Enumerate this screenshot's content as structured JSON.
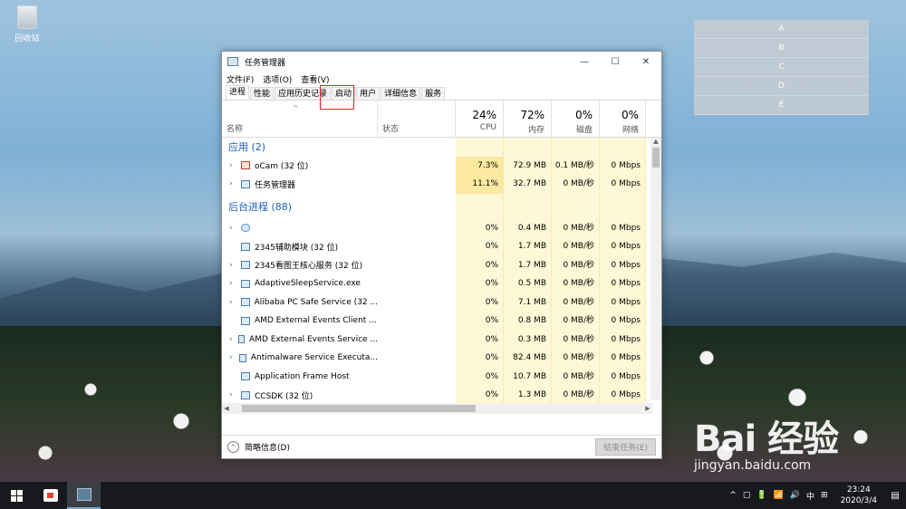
{
  "desktop": {
    "recycle_bin_label": "回收站"
  },
  "overlay_rows": [
    "A",
    "B",
    "C",
    "D",
    "E"
  ],
  "window": {
    "title": "任务管理器",
    "controls": {
      "minimize": "—",
      "maximize": "☐",
      "close": "✕"
    }
  },
  "menu": [
    "文件(F)",
    "选项(O)",
    "查看(V)"
  ],
  "tabs": [
    "进程",
    "性能",
    "应用历史记录",
    "启动",
    "用户",
    "详细信息",
    "服务"
  ],
  "active_tab": "进程",
  "highlighted_tab": "启动",
  "header": {
    "name_label": "名称",
    "status_label": "状态",
    "sort_glyph": "^",
    "columns": [
      {
        "pct": "24%",
        "label": "CPU"
      },
      {
        "pct": "72%",
        "label": "内存"
      },
      {
        "pct": "0%",
        "label": "磁盘"
      },
      {
        "pct": "0%",
        "label": "网络"
      }
    ]
  },
  "groups": {
    "apps": "应用 (2)",
    "background": "后台进程 (88)"
  },
  "apps": [
    {
      "name": "oCam (32 位)",
      "cpu": "7.3%",
      "mem": "72.9 MB",
      "disk": "0.1 MB/秒",
      "net": "0 Mbps",
      "icon": "ocam-icon",
      "hot": true
    },
    {
      "name": "任务管理器",
      "cpu": "11.1%",
      "mem": "32.7 MB",
      "disk": "0 MB/秒",
      "net": "0 Mbps",
      "icon": "task-manager-icon",
      "hot": true
    }
  ],
  "background": [
    {
      "name": "",
      "cpu": "0%",
      "mem": "0.4 MB",
      "disk": "0 MB/秒",
      "net": "0 Mbps",
      "icon": "gear-icon",
      "expand": true
    },
    {
      "name": "2345辅助模块 (32 位)",
      "cpu": "0%",
      "mem": "1.7 MB",
      "disk": "0 MB/秒",
      "net": "0 Mbps",
      "icon": "process-icon",
      "expand": false
    },
    {
      "name": "2345看图王核心服务 (32 位)",
      "cpu": "0%",
      "mem": "1.7 MB",
      "disk": "0 MB/秒",
      "net": "0 Mbps",
      "icon": "process-icon",
      "expand": true
    },
    {
      "name": "AdaptiveSleepService.exe",
      "cpu": "0%",
      "mem": "0.5 MB",
      "disk": "0 MB/秒",
      "net": "0 Mbps",
      "icon": "process-icon",
      "expand": true
    },
    {
      "name": "Alibaba PC Safe Service (32 ...",
      "cpu": "0%",
      "mem": "7.1 MB",
      "disk": "0 MB/秒",
      "net": "0 Mbps",
      "icon": "process-icon",
      "expand": true
    },
    {
      "name": "AMD External Events Client ...",
      "cpu": "0%",
      "mem": "0.8 MB",
      "disk": "0 MB/秒",
      "net": "0 Mbps",
      "icon": "process-icon",
      "expand": false
    },
    {
      "name": "AMD External Events Service ...",
      "cpu": "0%",
      "mem": "0.3 MB",
      "disk": "0 MB/秒",
      "net": "0 Mbps",
      "icon": "process-icon",
      "expand": true
    },
    {
      "name": "Antimalware Service Executa...",
      "cpu": "0%",
      "mem": "82.4 MB",
      "disk": "0 MB/秒",
      "net": "0 Mbps",
      "icon": "process-icon",
      "expand": true
    },
    {
      "name": "Application Frame Host",
      "cpu": "0%",
      "mem": "10.7 MB",
      "disk": "0 MB/秒",
      "net": "0 Mbps",
      "icon": "process-icon",
      "expand": false
    },
    {
      "name": "CCSDK (32 位)",
      "cpu": "0%",
      "mem": "1.3 MB",
      "disk": "0 MB/秒",
      "net": "0 Mbps",
      "icon": "process-icon",
      "expand": true
    }
  ],
  "footer": {
    "fewer_details": "简略信息(D)",
    "end_task": "结束任务(E)"
  },
  "taskbar": {
    "tray": [
      "^",
      "▢",
      "🔋",
      "📶",
      "🔊",
      "中",
      "⊞"
    ],
    "time": "23:24",
    "date": "2020/3/4"
  },
  "watermark": {
    "brand": "Bai 经验",
    "url": "jingyan.baidu.com"
  }
}
